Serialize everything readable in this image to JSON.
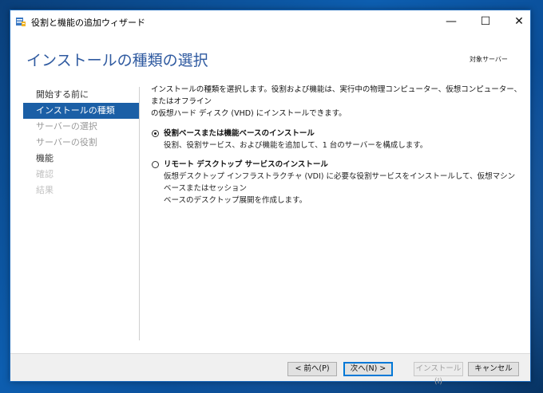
{
  "window": {
    "title": "役割と機能の追加ウィザード",
    "icon": "server-manager-icon",
    "controls": {
      "minimize": "—",
      "maximize": "☐",
      "close": "✕"
    }
  },
  "header": {
    "title": "インストールの種類の選択",
    "target_server": "対象サーバー"
  },
  "nav": {
    "items": [
      {
        "label": "開始する前に",
        "state": "normal"
      },
      {
        "label": "インストールの種類",
        "state": "active"
      },
      {
        "label": "サーバーの選択",
        "state": "disabled"
      },
      {
        "label": "サーバーの役割",
        "state": "disabled"
      },
      {
        "label": "機能",
        "state": "normal"
      },
      {
        "label": "確認",
        "state": "very-disabled"
      },
      {
        "label": "結果",
        "state": "very-disabled"
      }
    ]
  },
  "content": {
    "intro_line1": "インストールの種類を選択します。役割および機能は、実行中の物理コンピューター、仮想コンピューター、またはオフライン",
    "intro_line2": "の仮想ハード ディスク (VHD) にインストールできます。",
    "options": [
      {
        "title": "役割ベースまたは機能ベースのインストール",
        "desc_line1": "役割、役割サービス、および機能を追加して、1 台のサーバーを構成します。",
        "desc_line2": "",
        "checked": true
      },
      {
        "title": "リモート デスクトップ サービスのインストール",
        "desc_line1": "仮想デスクトップ インフラストラクチャ (VDI) に必要な役割サービスをインストールして、仮想マシン ベースまたはセッション",
        "desc_line2": "ベースのデスクトップ展開を作成します。",
        "checked": false
      }
    ]
  },
  "footer": {
    "prev": "< 前へ(P)",
    "next": "次へ(N) >",
    "install": "インストール(I)",
    "cancel": "キャンセル"
  },
  "colors": {
    "accent": "#1b5fa6",
    "header_title": "#2f5aa0",
    "desktop": "#0d5eb0"
  }
}
